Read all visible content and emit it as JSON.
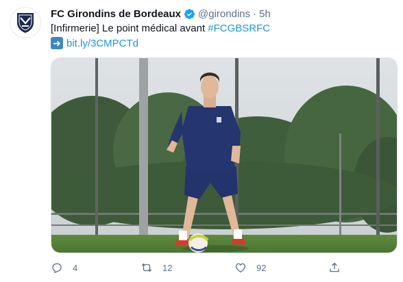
{
  "tweet": {
    "author_name": "FC Girondins de Bordeaux",
    "handle": "@girondins",
    "separator": "·",
    "time": "5h",
    "text_prefix": "[Infirmerie] Le point médical avant ",
    "hashtag": "#FCGBSRFC",
    "link_icon": "arrow-right-emoji",
    "link": "bit.ly/3CMPCTd",
    "verified": true,
    "avatar": "fc-girondins-crest"
  },
  "actions": {
    "reply_count": "4",
    "retweet_count": "12",
    "like_count": "92"
  },
  "colors": {
    "link": "#1b95e0",
    "muted": "#5b7083",
    "verified": "#1da1f2",
    "club_navy": "#1d2a4f"
  }
}
